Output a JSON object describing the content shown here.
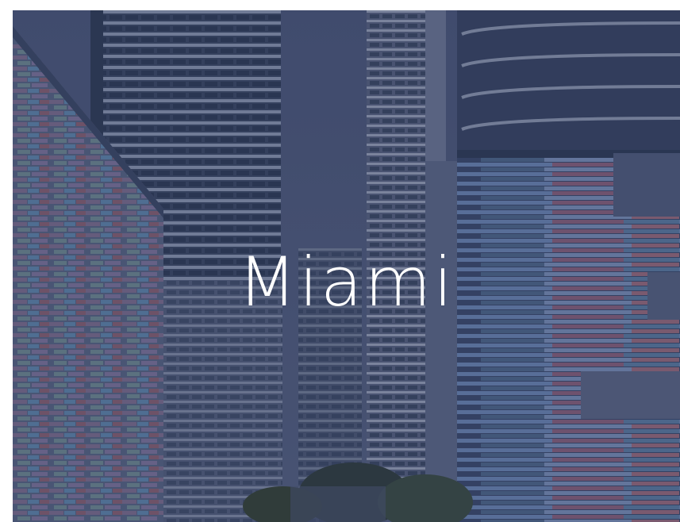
{
  "card": {
    "title": "Miami",
    "overlay_color": "#2b3a5c"
  },
  "image": {
    "subject": "city-skyline-photo"
  }
}
